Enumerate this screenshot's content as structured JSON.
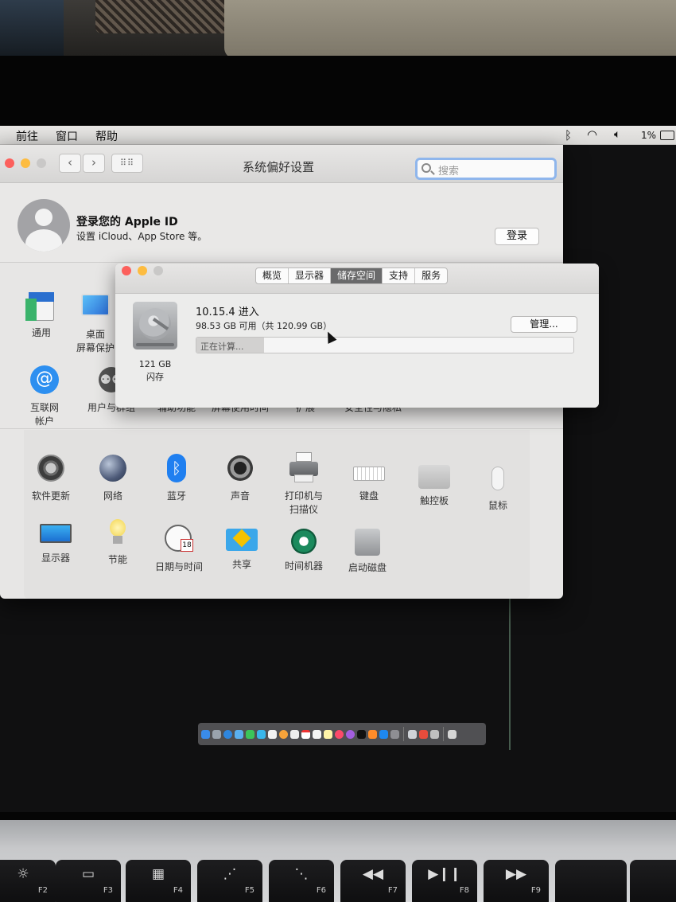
{
  "menubar": {
    "items": [
      "前往",
      "窗口",
      "帮助"
    ],
    "battery": "1%"
  },
  "prefs": {
    "title": "系统偏好设置",
    "search_placeholder": "搜索",
    "account_title": "登录您的 Apple ID",
    "account_subtitle": "设置 iCloud、App Store 等。",
    "login_label": "登录",
    "row1": [
      {
        "label": "通用",
        "icon": "general-icon"
      },
      {
        "label": "桌面\n屏幕保护",
        "icon": "desktop-icon"
      }
    ],
    "row1b": [
      {
        "label": "互联网\n帐户",
        "icon": "internet-accounts-icon"
      },
      {
        "label": "用户与群组",
        "icon": "users-groups-icon"
      },
      {
        "label": "辅助功能",
        "icon": "accessibility-icon"
      },
      {
        "label": "屏幕使用时间",
        "icon": "screen-time-icon"
      },
      {
        "label": "扩展",
        "icon": "extensions-icon"
      },
      {
        "label": "安全性与隐私",
        "icon": "security-icon"
      }
    ],
    "row2": [
      {
        "label": "软件更新",
        "icon": "software-update-icon"
      },
      {
        "label": "网络",
        "icon": "network-icon"
      },
      {
        "label": "蓝牙",
        "icon": "bluetooth-icon"
      },
      {
        "label": "声音",
        "icon": "sound-icon"
      },
      {
        "label": "打印机与\n扫描仪",
        "icon": "printer-icon"
      },
      {
        "label": "键盘",
        "icon": "keyboard-icon"
      },
      {
        "label": "触控板",
        "icon": "trackpad-icon"
      },
      {
        "label": "鼠标",
        "icon": "mouse-icon"
      }
    ],
    "row3": [
      {
        "label": "显示器",
        "icon": "displays-icon"
      },
      {
        "label": "节能",
        "icon": "energy-icon"
      },
      {
        "label": "日期与时间",
        "icon": "date-time-icon"
      },
      {
        "label": "共享",
        "icon": "sharing-icon"
      },
      {
        "label": "时间机器",
        "icon": "time-machine-icon"
      },
      {
        "label": "启动磁盘",
        "icon": "startup-disk-icon"
      }
    ]
  },
  "about": {
    "tabs": [
      "概览",
      "显示器",
      "储存空间",
      "支持",
      "服务"
    ],
    "selected_tab": "储存空间",
    "os_version": "10.15.4 进入",
    "available": "98.53 GB 可用（共 120.99 GB）",
    "disk_size": "121 GB",
    "disk_type": "闪存",
    "manage_label": "管理...",
    "progress_text": "正在计算...",
    "progress_fraction": 0.18
  },
  "calendar_day": "18",
  "keyboard": {
    "keys": [
      {
        "label": "F2",
        "glyph": "☼"
      },
      {
        "label": "F3",
        "glyph": "▭"
      },
      {
        "label": "F4",
        "glyph": "▦"
      },
      {
        "label": "F5",
        "glyph": "⋰"
      },
      {
        "label": "F6",
        "glyph": "⋱"
      },
      {
        "label": "F7",
        "glyph": "◀◀"
      },
      {
        "label": "F8",
        "glyph": "▶❙❙"
      },
      {
        "label": "F9",
        "glyph": "▶▶"
      }
    ]
  },
  "colors": {
    "accent": "#8fb6ec",
    "close": "#fc605c",
    "minimize": "#fdbc40",
    "selected_tab": "#6a6a6b"
  }
}
